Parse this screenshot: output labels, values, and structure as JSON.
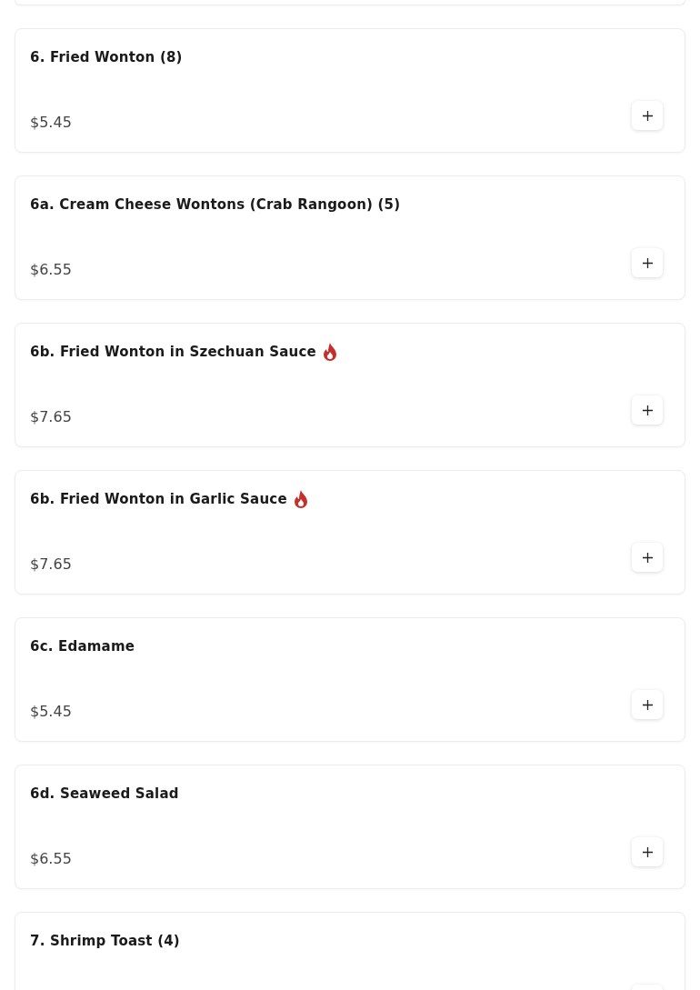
{
  "items": [
    {
      "name": "6. Fried Wonton (8)",
      "spicy": false,
      "price": "$5.45"
    },
    {
      "name": "6a. Cream Cheese Wontons (Crab Rangoon) (5)",
      "spicy": false,
      "price": "$6.55"
    },
    {
      "name": "6b. Fried Wonton in Szechuan Sauce",
      "spicy": true,
      "price": "$7.65"
    },
    {
      "name": "6b. Fried Wonton in Garlic Sauce",
      "spicy": true,
      "price": "$7.65"
    },
    {
      "name": "6c. Edamame",
      "spicy": false,
      "price": "$5.45"
    },
    {
      "name": "6d. Seaweed Salad",
      "spicy": false,
      "price": "$6.55"
    },
    {
      "name": "7. Shrimp Toast (4)",
      "spicy": false
    }
  ]
}
